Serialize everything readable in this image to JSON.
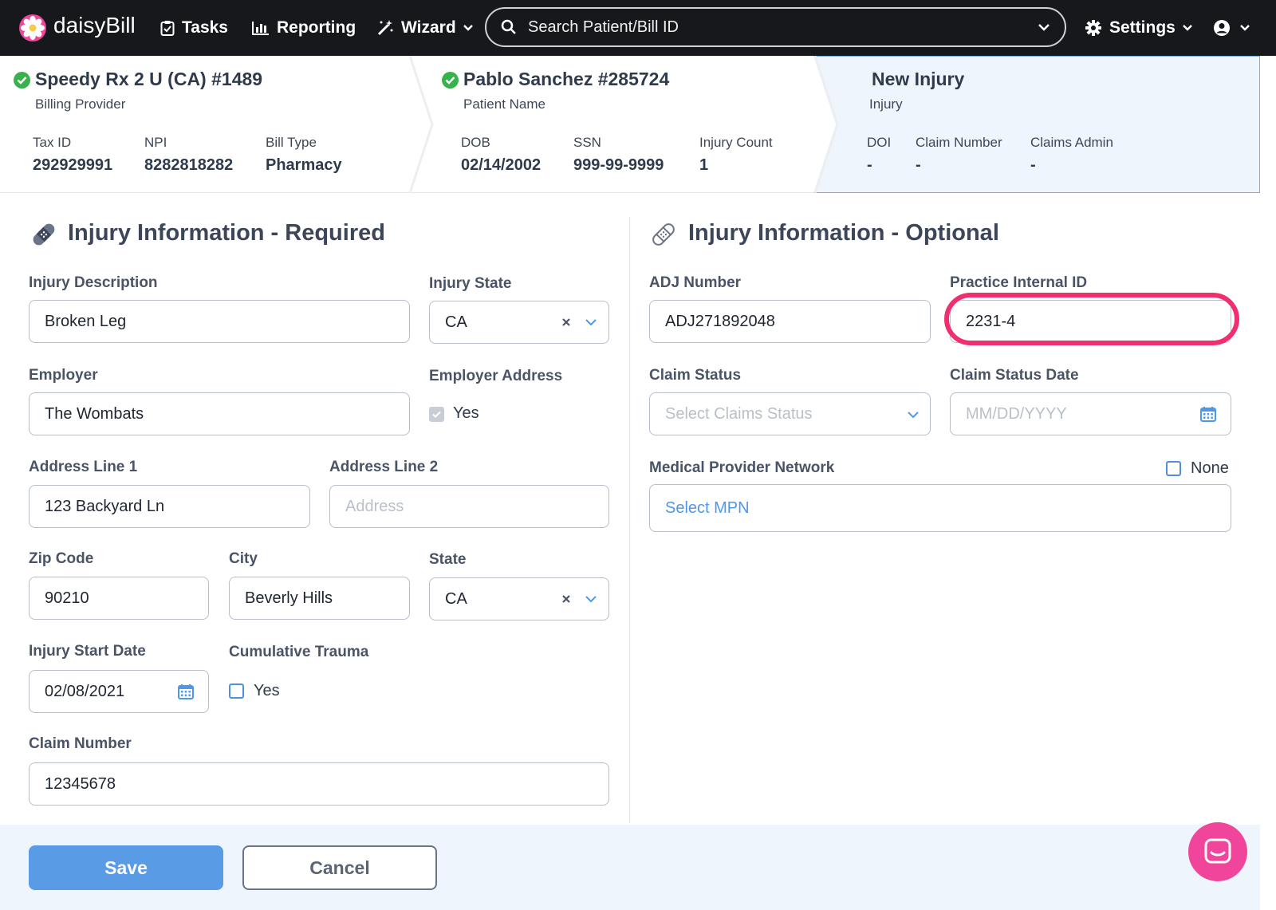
{
  "topbar": {
    "logo": "daisyBill",
    "nav": {
      "tasks": "Tasks",
      "reporting": "Reporting",
      "wizard": "Wizard",
      "settings": "Settings"
    },
    "search_placeholder": "Search Patient/Bill ID"
  },
  "header": {
    "provider": {
      "title": "Speedy Rx 2 U (CA) #1489",
      "subtitle": "Billing Provider",
      "fields": [
        {
          "label": "Tax ID",
          "value": "292929991"
        },
        {
          "label": "NPI",
          "value": "8282818282"
        },
        {
          "label": "Bill Type",
          "value": "Pharmacy"
        }
      ]
    },
    "patient": {
      "title": "Pablo Sanchez #285724",
      "subtitle": "Patient Name",
      "fields": [
        {
          "label": "DOB",
          "value": "02/14/2002"
        },
        {
          "label": "SSN",
          "value": "999-99-9999"
        },
        {
          "label": "Injury Count",
          "value": "1"
        }
      ]
    },
    "injury": {
      "title": "New Injury",
      "subtitle": "Injury",
      "fields": [
        {
          "label": "DOI",
          "value": "-"
        },
        {
          "label": "Claim Number",
          "value": "-"
        },
        {
          "label": "Claims Admin",
          "value": "-"
        }
      ]
    }
  },
  "required": {
    "title": "Injury Information - Required",
    "injury_description": {
      "label": "Injury Description",
      "value": "Broken Leg"
    },
    "injury_state": {
      "label": "Injury State",
      "value": "CA"
    },
    "employer": {
      "label": "Employer",
      "value": "The Wombats"
    },
    "employer_address": {
      "label": "Employer Address",
      "option": "Yes",
      "checked": true
    },
    "address_line_1": {
      "label": "Address Line 1",
      "value": "123 Backyard Ln"
    },
    "address_line_2": {
      "label": "Address Line 2",
      "placeholder": "Address"
    },
    "zip_code": {
      "label": "Zip Code",
      "value": "90210"
    },
    "city": {
      "label": "City",
      "value": "Beverly Hills"
    },
    "state": {
      "label": "State",
      "value": "CA"
    },
    "injury_start_date": {
      "label": "Injury Start Date",
      "value": "02/08/2021"
    },
    "cumulative_trauma": {
      "label": "Cumulative Trauma",
      "option": "Yes",
      "checked": false
    },
    "claim_number": {
      "label": "Claim Number",
      "value": "12345678"
    }
  },
  "optional": {
    "title": "Injury Information - Optional",
    "adj_number": {
      "label": "ADJ Number",
      "value": "ADJ271892048"
    },
    "practice_internal_id": {
      "label": "Practice Internal ID",
      "value": "2231-4"
    },
    "claim_status": {
      "label": "Claim Status",
      "placeholder": "Select Claims Status"
    },
    "claim_status_date": {
      "label": "Claim Status Date",
      "placeholder": "MM/DD/YYYY"
    },
    "mpn": {
      "label": "Medical Provider Network",
      "none_label": "None",
      "select_label": "Select MPN"
    }
  },
  "footer": {
    "save": "Save",
    "cancel": "Cancel"
  },
  "colors": {
    "accent": "#4f97e8",
    "highlight": "#f0306e",
    "success": "#37b24d",
    "topbar": "#16181b"
  }
}
